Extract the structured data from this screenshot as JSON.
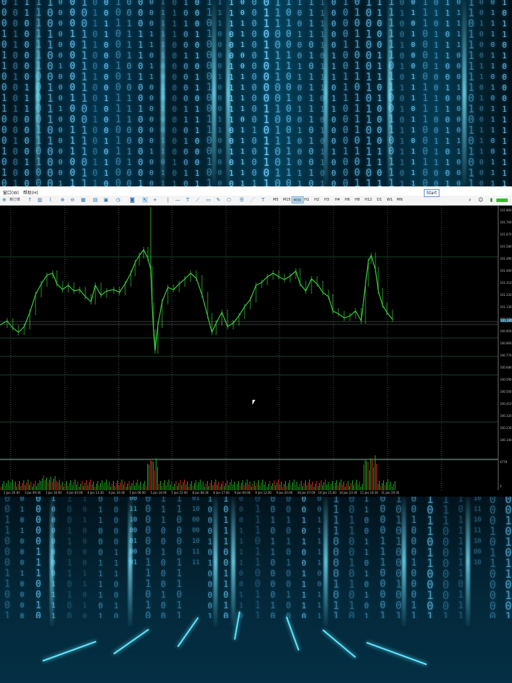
{
  "window": {
    "title": "..."
  },
  "menu": [
    {
      "label": "窗口(W)"
    },
    {
      "label": "帮助(H)"
    }
  ],
  "toolbar": {
    "new_order_label": "新订单",
    "timeframes": [
      "M5",
      "M15",
      "M30",
      "H1",
      "H2",
      "H3",
      "H4",
      "H6",
      "H8",
      "H12",
      "D1",
      "W1",
      "MN"
    ],
    "active_timeframe": "M30"
  },
  "start_button": {
    "label": "Start"
  },
  "chart": {
    "price_labels": [
      "101.860",
      "101.760",
      "101.670",
      "101.580",
      "101.490",
      "101.400",
      "101.310",
      "101.220",
      "101.130",
      "101.040",
      "100.950",
      "100.860",
      "100.770",
      "100.680",
      "100.590",
      "100.500",
      "100.410",
      "100.320",
      "100.230",
      "100.140"
    ],
    "current_price": "101.285",
    "volume_max": "4779",
    "volume_min": "0",
    "time_labels": [
      "2 Jan 20:30",
      "3 Jan 09:30",
      "3 Jan 16:00",
      "4 Jan 03:00",
      "4 Jan 13:30",
      "4 Jan 19:30",
      "5 Jan 06:00",
      "5 Jan 14:00",
      "5 Jan 22:00",
      "8 Jan 08:30",
      "8 Jan 17:00",
      "9 Jan 04:00",
      "9 Jan 12:00",
      "9 Jan 20:00",
      "10 Jan 07:00",
      "10 Jan 15:00",
      "10 Jan 23:30",
      "11 Jan 10:30",
      "11 Jan 19:30"
    ],
    "colors": {
      "candle": "#3cd33c",
      "volume_up": "#1fa51f",
      "volume_down": "#c81e1e",
      "grid": "#555555",
      "background": "#000000"
    }
  }
}
